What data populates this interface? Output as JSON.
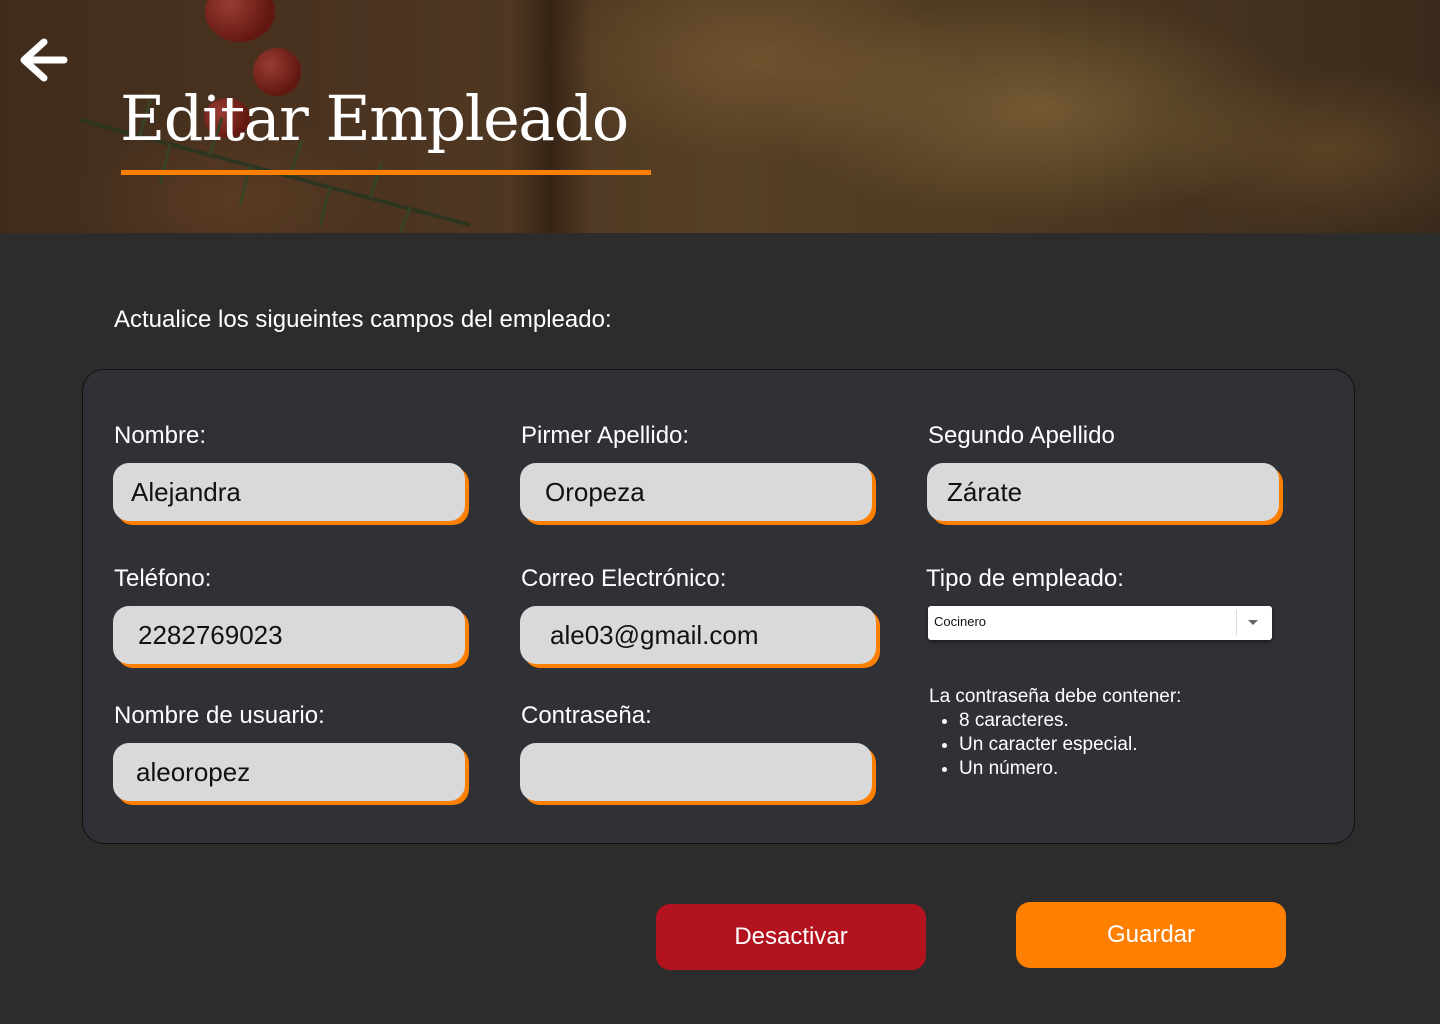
{
  "header": {
    "title": "Editar Empleado",
    "back_icon": "arrow-left-icon"
  },
  "instruction": "Actualice los sigueintes campos del empleado:",
  "form": {
    "nombre": {
      "label": "Nombre:",
      "value": "Alejandra"
    },
    "primer_apellido": {
      "label": "Pirmer Apellido:",
      "value": "Oropeza"
    },
    "segundo_apellido": {
      "label": "Segundo Apellido",
      "value": "Zárate"
    },
    "telefono": {
      "label": "Teléfono:",
      "value": "2282769023"
    },
    "correo": {
      "label": "Correo Electrónico:",
      "value": "ale03@gmail.com"
    },
    "tipo_empleado": {
      "label": "Tipo de empleado:",
      "selected": "Cocinero"
    },
    "usuario": {
      "label": "Nombre de usuario:",
      "value": "aleoropez"
    },
    "contrasena": {
      "label": "Contraseña:",
      "value": ""
    },
    "password_rules": {
      "heading": "La contraseña debe contener:",
      "items": [
        "8 caracteres.",
        "Un caracter especial.",
        "Un número."
      ]
    }
  },
  "buttons": {
    "deactivate": "Desactivar",
    "save": "Guardar"
  },
  "colors": {
    "accent": "#ff7f00",
    "danger": "#b3131f",
    "background": "#2c2c2c",
    "card": "#2f3136",
    "input": "#d9d9d9"
  }
}
